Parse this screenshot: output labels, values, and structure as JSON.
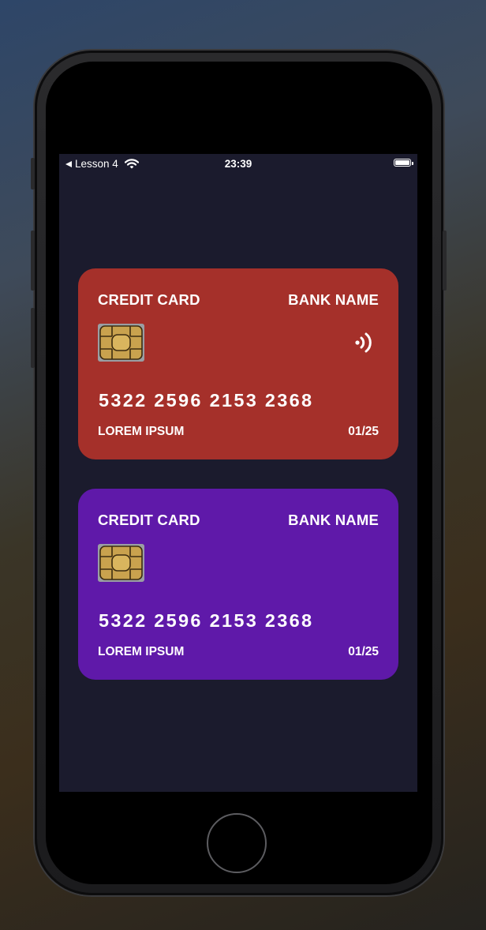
{
  "status_bar": {
    "back_label": "Lesson 4",
    "time": "23:39",
    "wifi_icon": "wifi-icon",
    "battery_icon": "battery-icon"
  },
  "cards": [
    {
      "type_label": "CREDIT CARD",
      "bank_name": "BANK NAME",
      "number": "5322 2596 2153 2368",
      "holder": "LOREM IPSUM",
      "expiry": "01/25",
      "color": "#a5302a",
      "contactless": true,
      "icons": [
        "chip-icon",
        "contactless-icon"
      ]
    },
    {
      "type_label": "CREDIT CARD",
      "bank_name": "BANK NAME",
      "number": "5322 2596 2153 2368",
      "holder": "LOREM IPSUM",
      "expiry": "01/25",
      "color": "#5f19a9",
      "contactless": false,
      "icons": [
        "chip-icon"
      ]
    }
  ],
  "colors": {
    "screen_background": "#1b1b2d",
    "text": "#ffffff"
  }
}
